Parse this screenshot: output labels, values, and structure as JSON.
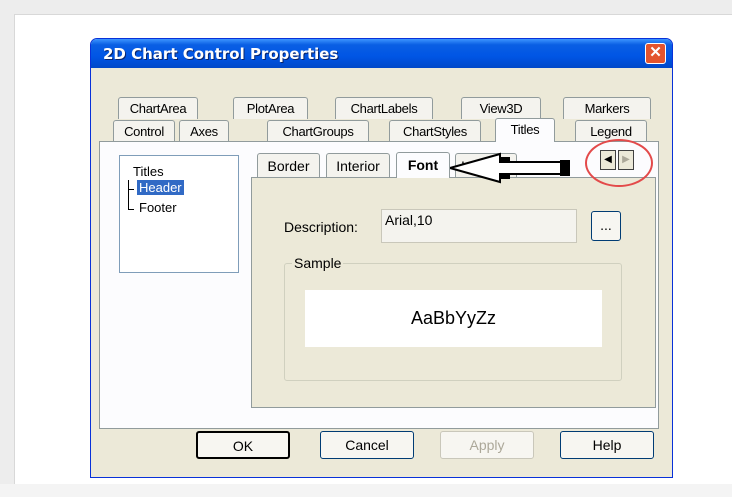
{
  "dialog": {
    "title": "2D Chart Control Properties",
    "close_glyph": "✕"
  },
  "tabs_row1": [
    "ChartArea",
    "PlotArea",
    "ChartLabels",
    "View3D",
    "Markers"
  ],
  "tabs_row2": [
    "Control",
    "Axes",
    "ChartGroups",
    "ChartStyles",
    "Titles",
    "Legend"
  ],
  "active_tab": "Titles",
  "tree": {
    "root": "Titles",
    "items": [
      "Header",
      "Footer"
    ],
    "selected": "Header"
  },
  "subtabs": [
    "Border",
    "Interior",
    "Font",
    "Image"
  ],
  "active_subtab": "Font",
  "scroll": {
    "left_glyph": "◀",
    "right_glyph": "▶"
  },
  "font": {
    "description_label": "Description:",
    "description_value": "Arial,10",
    "browse_label": "...",
    "sample_label": "Sample",
    "sample_text": "AaBbYyZz"
  },
  "buttons": {
    "ok": "OK",
    "cancel": "Cancel",
    "apply": "Apply",
    "help": "Help"
  },
  "colors": {
    "titlebar": "#0055e5",
    "highlight": "#e34a4a",
    "selection": "#316ac5"
  }
}
